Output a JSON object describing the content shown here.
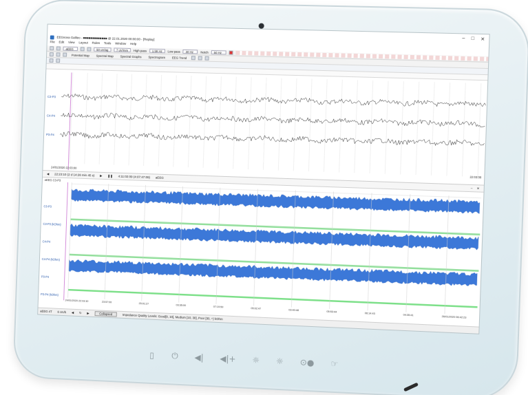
{
  "app": {
    "title": "EEGnova Galileo - ■■■■■■■■■■■■■ @ 22.01.2020 00:00:00 - [Replay]",
    "window_controls": [
      "–",
      "□",
      "✕"
    ]
  },
  "menu": [
    "File",
    "Edit",
    "View",
    "Layout",
    "Rules",
    "Tools",
    "Window",
    "Help"
  ],
  "toolbar1": {
    "montage": "aEEG",
    "sensitivity": "50 uV/ag",
    "timebase": "7 uV/mm",
    "highpass_label": "High pass",
    "highpass_value": "1.59 Hz",
    "lowpass_label": "Low pass",
    "lowpass_value": "30 Hz",
    "notch_label": "Notch",
    "notch_value": "50 Hz"
  },
  "toolbar2": {
    "items": [
      "Potential Map",
      "Spectral Map",
      "Spectral Graphs",
      "Spectrogram",
      "EEG Trend"
    ]
  },
  "eeg": {
    "channels": [
      "C3-P3",
      "C4-P4",
      "P3-P4"
    ],
    "start_time": "24/01/2020 22:03:00",
    "end_timecode": "22:03:08"
  },
  "navigation": {
    "position": "22:23:10 (2 d 14:26 min 45 s)",
    "duration": "4:11:02:09 (4:07:47:09)",
    "view": "aEEG"
  },
  "aeeg": {
    "header": "aEEG C3-P3",
    "labels": [
      "C3-P3",
      "C3-P3 (kOhm)",
      "C4-P4",
      "C4-P4 (kOhm)",
      "P3-P4",
      "P3-P4 (kOhm)"
    ],
    "x_ticks": [
      "24/01/2020 22:03:10",
      "23:57:00",
      "25:01:27",
      "03:35:00",
      "07:19:50",
      "05:02:47",
      "03:40:48",
      "05:53:44",
      "06:14:43",
      "04:35:41",
      "26/01/2020 06:42:23"
    ]
  },
  "status": {
    "mode": "aEEG 4T",
    "speed": "6 cm/h",
    "collapse": "Collapsed",
    "impedance": "Impedance Quality Levels: Good[0, 10], Medium [10, 30], Poor [30, +) kOhm"
  },
  "hardware_buttons": [
    "▯",
    "⏻",
    "◀|",
    "◀|+",
    "☼",
    "☼",
    "⊙●",
    "☞"
  ],
  "colors": {
    "eeg_trace": "#2a2a2a",
    "aeeg_band": "#3c78d8",
    "impedance_line": "#7ee08a",
    "cursor_line": "#c86fd0"
  }
}
